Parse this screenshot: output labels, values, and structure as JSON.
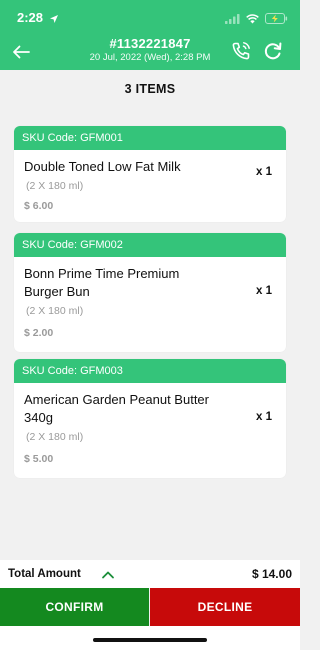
{
  "status_bar": {
    "time": "2:28"
  },
  "header": {
    "order_id": "#1132221847",
    "order_date": "20 Jul, 2022 (Wed),  2:28 PM",
    "bg_color": "#34c47a"
  },
  "items_count": "3 ITEMS",
  "items": [
    {
      "sku": "SKU Code: GFM001",
      "name": "Double Toned Low Fat Milk",
      "pack": "(2 X 180 ml)",
      "price": "$ 6.00",
      "qty": "x 1"
    },
    {
      "sku": "SKU Code: GFM002",
      "name": "Bonn Prime Time Premium Burger Bun",
      "pack": "(2 X 180 ml)",
      "price": "$ 2.00",
      "qty": "x 1"
    },
    {
      "sku": "SKU Code: GFM003",
      "name": "American Garden Peanut Butter 340g",
      "pack": "(2 X 180 ml)",
      "price": "$ 5.00",
      "qty": "x 1"
    }
  ],
  "footer": {
    "total_label": "Total Amount",
    "total_value": "$ 14.00",
    "confirm_label": "CONFIRM",
    "decline_label": "DECLINE",
    "confirm_color": "#14891f",
    "decline_color": "#c70a0a"
  },
  "icons": [
    "back-arrow-icon",
    "phone-call-icon",
    "refresh-icon",
    "chevron-up-icon",
    "location-arrow-icon",
    "signal-icon",
    "wifi-icon",
    "battery-icon"
  ]
}
